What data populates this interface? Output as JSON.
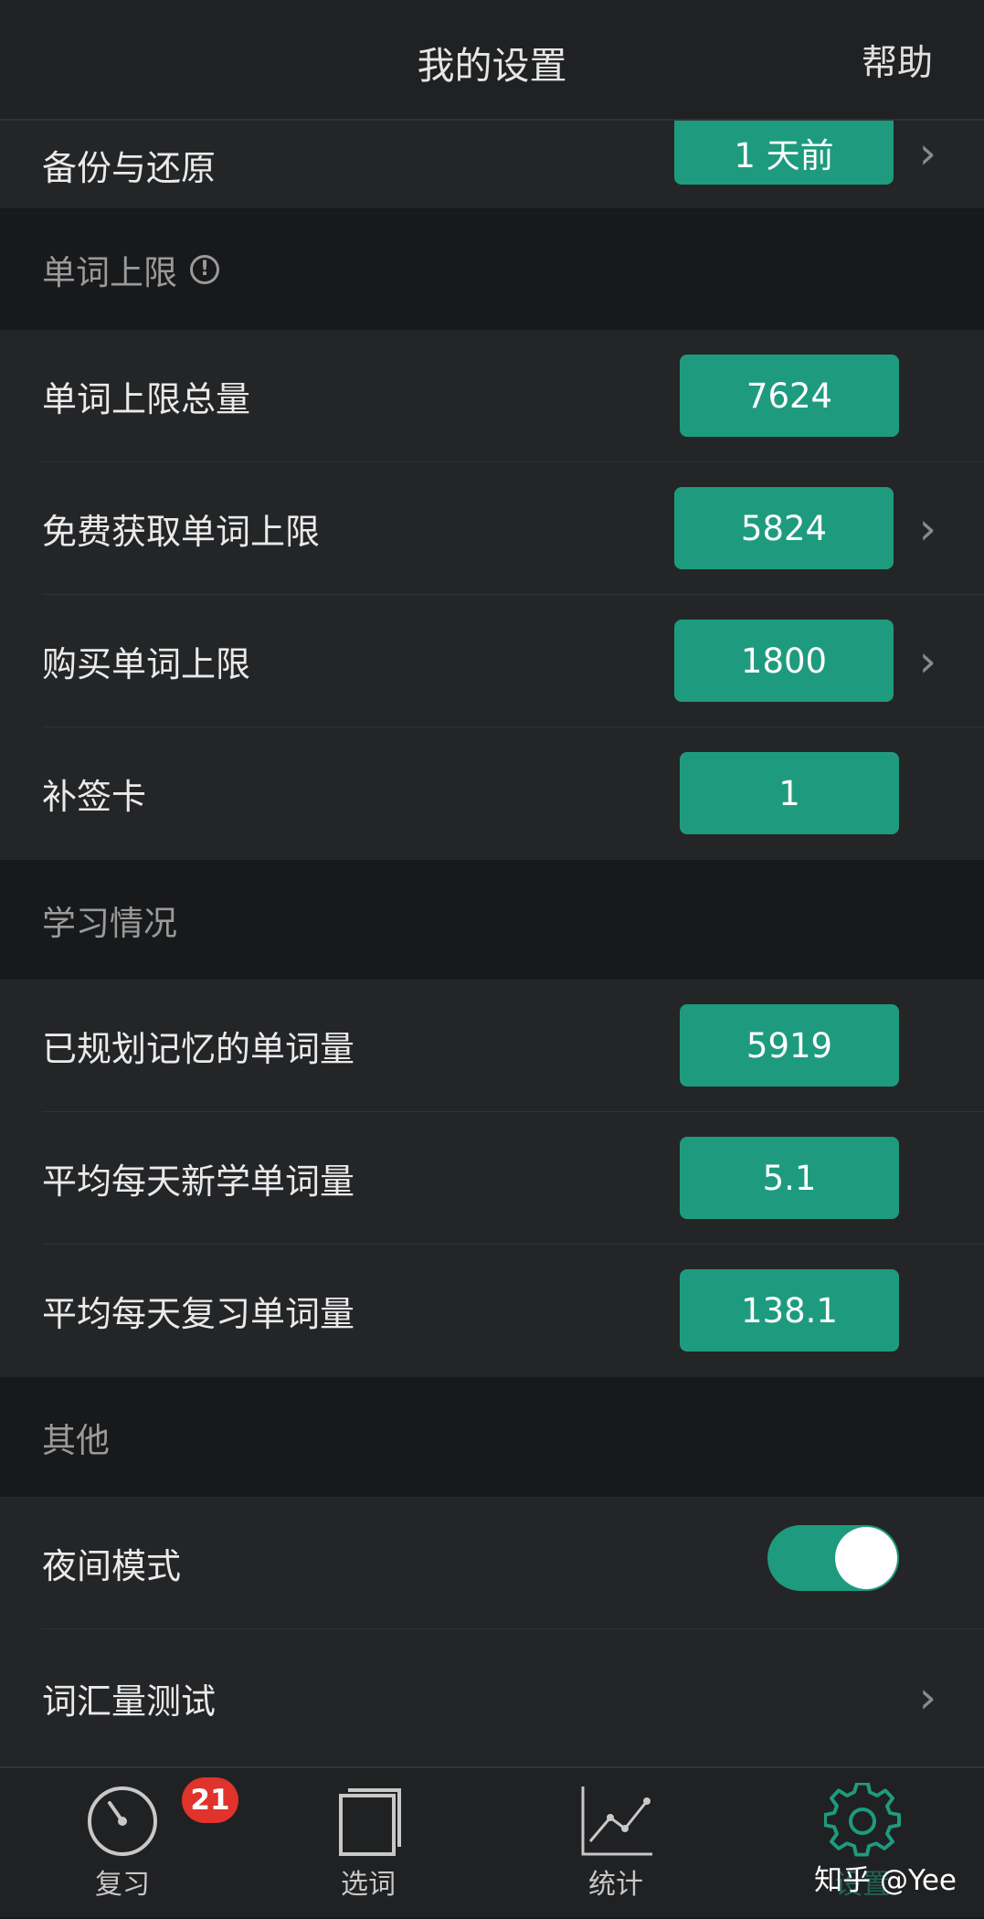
{
  "header": {
    "title": "我的设置",
    "help": "帮助"
  },
  "backup_row": {
    "label": "备份与还原",
    "value": "1 天前"
  },
  "word_limit": {
    "section_title": "单词上限",
    "rows": [
      {
        "label": "单词上限总量",
        "value": "7624"
      },
      {
        "label": "免费获取单词上限",
        "value": "5824"
      },
      {
        "label": "购买单词上限",
        "value": "1800"
      },
      {
        "label": "补签卡",
        "value": "1"
      }
    ]
  },
  "study": {
    "section_title": "学习情况",
    "rows": [
      {
        "label": "已规划记忆的单词量",
        "value": "5919"
      },
      {
        "label": "平均每天新学单词量",
        "value": "5.1"
      },
      {
        "label": "平均每天复习单词量",
        "value": "138.1"
      }
    ]
  },
  "other": {
    "section_title": "其他",
    "night_mode": {
      "label": "夜间模式",
      "enabled": true
    },
    "vocab_test": {
      "label": "词汇量测试"
    }
  },
  "tabbar": {
    "review": {
      "label": "复习",
      "badge": "21"
    },
    "select": {
      "label": "选词"
    },
    "stats": {
      "label": "统计"
    },
    "settings": {
      "label": "设置"
    }
  },
  "watermark": "知乎 @Yee",
  "colors": {
    "accent": "#1e9b7e",
    "badge": "#e0332b",
    "background": "#18191b",
    "row": "#242527"
  }
}
